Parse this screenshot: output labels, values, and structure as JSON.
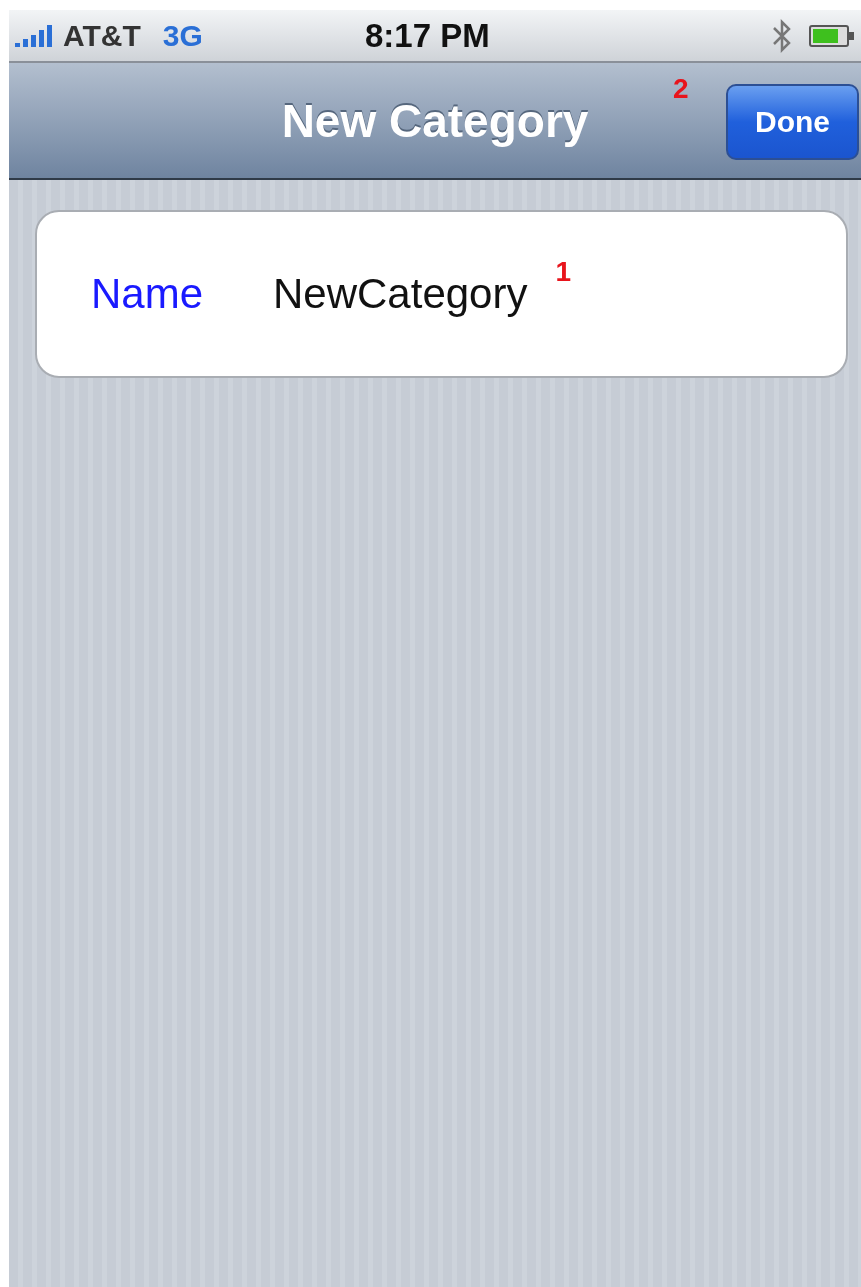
{
  "status_bar": {
    "carrier": "AT&T",
    "network": "3G",
    "time": "8:17 PM"
  },
  "nav_bar": {
    "title": "New Category",
    "done_button": "Done",
    "marker": "2"
  },
  "form": {
    "rows": [
      {
        "label": "Name",
        "value": "NewCategory",
        "marker": "1"
      }
    ]
  }
}
